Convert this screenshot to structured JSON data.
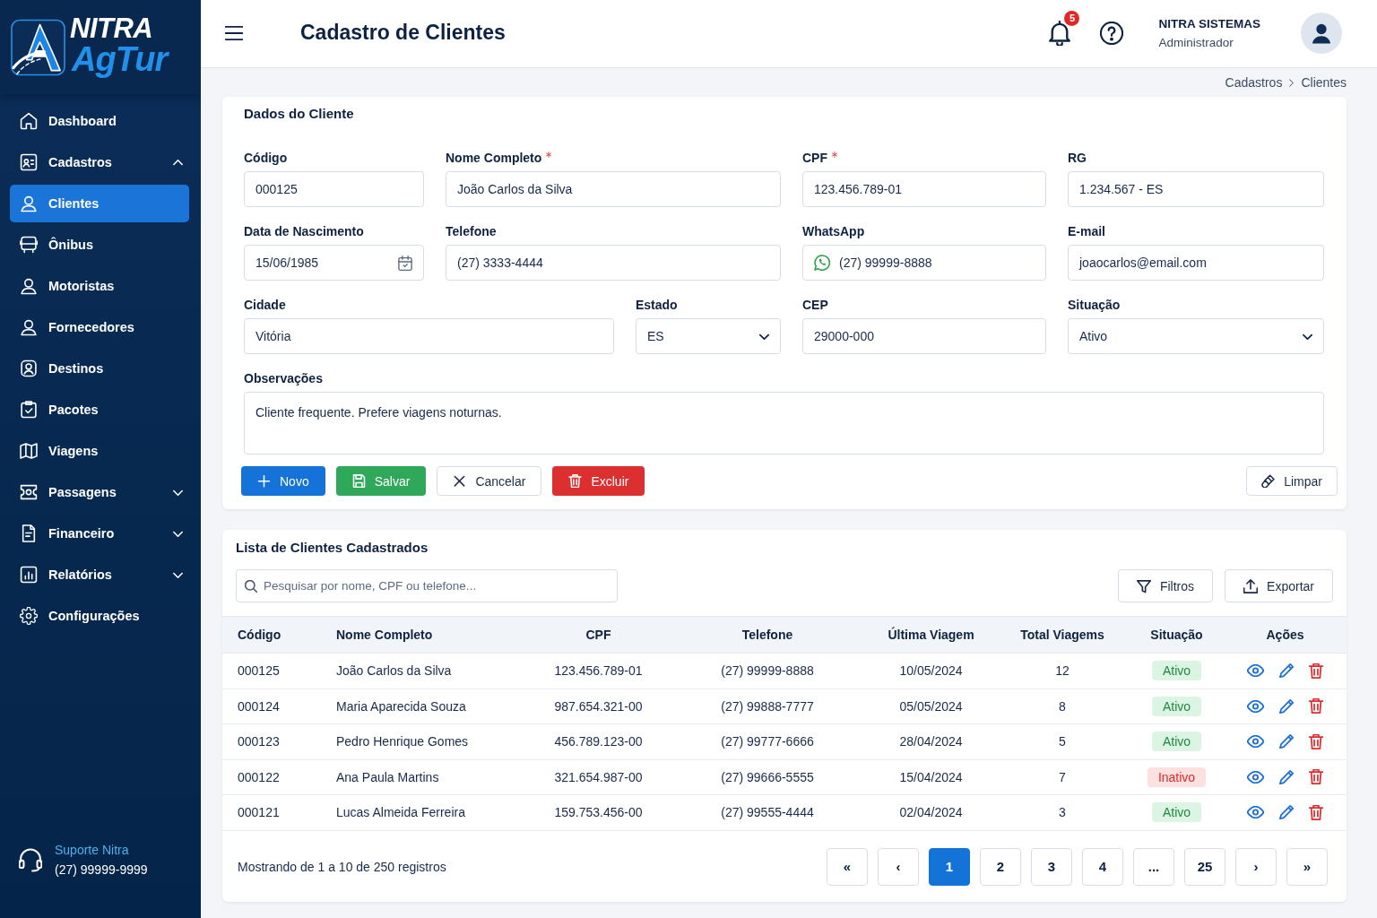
{
  "sidebar": {
    "logo": {
      "line_1": "NITRA",
      "line_2": "AgTur"
    },
    "items": [
      {
        "label": "Dashboard",
        "kind": "link",
        "selected": false
      },
      {
        "label": "Cadastros",
        "kind": "group",
        "selected": false,
        "expanded": true
      },
      {
        "label": "Clientes",
        "kind": "link",
        "selected": true
      },
      {
        "label": "Ônibus",
        "kind": "link",
        "selected": false
      },
      {
        "label": "Motoristas",
        "kind": "link",
        "selected": false
      },
      {
        "label": "Fornecedores",
        "kind": "link",
        "selected": false
      },
      {
        "label": "Destinos",
        "kind": "link",
        "selected": false
      },
      {
        "label": "Pacotes",
        "kind": "link",
        "selected": false
      },
      {
        "label": "Viagens",
        "kind": "link",
        "selected": false
      },
      {
        "label": "Passagens",
        "kind": "group",
        "selected": false,
        "expanded": false
      },
      {
        "label": "Financeiro",
        "kind": "group",
        "selected": false,
        "expanded": false
      },
      {
        "label": "Relatórios",
        "kind": "group",
        "selected": false,
        "expanded": false
      },
      {
        "label": "Configurações",
        "kind": "link",
        "selected": false
      }
    ],
    "support": {
      "title": "Suporte Nitra",
      "phone": "(27) 99999-9999"
    }
  },
  "header": {
    "title": "Cadastro de Clientes",
    "notifications": "5",
    "user": {
      "name": "NITRA SISTEMAS",
      "role": "Administrador"
    }
  },
  "breadcrumb": [
    "Cadastros",
    "Clientes"
  ],
  "client_form": {
    "title": "Dados do Cliente",
    "rows": [
      [
        {
          "label": "Código",
          "value": "000125",
          "kind": "text",
          "required": false
        },
        {
          "label": "Nome Completo",
          "value": "João Carlos da Silva",
          "kind": "text",
          "required": true
        },
        {
          "label": "CPF",
          "value": "123.456.789-01",
          "kind": "text",
          "required": true
        },
        {
          "label": "RG",
          "value": "1.234.567 - ES",
          "kind": "text",
          "required": false
        }
      ],
      [
        {
          "label": "Data de Nascimento",
          "value": "15/06/1985",
          "kind": "date",
          "required": false
        },
        {
          "label": "Telefone",
          "value": "(27) 3333-4444",
          "kind": "text",
          "required": false
        },
        {
          "label": "WhatsApp",
          "value": "(27) 99999-8888",
          "kind": "whatsapp",
          "required": false
        },
        {
          "label": "E-mail",
          "value": "joaocarlos@email.com",
          "kind": "text",
          "required": false
        }
      ],
      [
        {
          "label": "Cidade",
          "value": "Vitória",
          "kind": "text",
          "required": false
        },
        {
          "label": "Estado",
          "value": "ES",
          "kind": "select",
          "required": false
        },
        {
          "label": "CEP",
          "value": "29000-000",
          "kind": "text",
          "required": false
        },
        {
          "label": "Situação",
          "value": "Ativo",
          "kind": "select",
          "required": false
        }
      ],
      [
        {
          "label": "Observações",
          "value": "Cliente frequente. Prefere viagens noturnas.",
          "kind": "textarea",
          "required": false
        }
      ]
    ],
    "actions": [
      {
        "label": "Novo",
        "kind": "new"
      },
      {
        "label": "Salvar",
        "kind": "save"
      },
      {
        "label": "Cancelar",
        "kind": "cancel"
      },
      {
        "label": "Excluir",
        "kind": "delete"
      },
      {
        "label": "Limpar",
        "kind": "clear"
      }
    ]
  },
  "client_list": {
    "title": "Lista de Clientes Cadastrados",
    "search": {
      "placeholder": "Pesquisar por nome, CPF ou telefone..."
    },
    "tools": [
      {
        "label": "Filtros",
        "kind": "filter"
      },
      {
        "label": "Exportar",
        "kind": "export"
      }
    ],
    "table": {
      "columns": [
        "Código",
        "Nome Completo",
        "CPF",
        "Telefone",
        "Última Viagem",
        "Total Viagems",
        "Situação",
        "Ações"
      ],
      "rows": [
        {
          "cells": [
            "000125",
            "João Carlos da Silva",
            "123.456.789-01",
            "(27) 99999-8888",
            "10/05/2024",
            "12"
          ],
          "status": {
            "label": "Ativo",
            "active": true
          }
        },
        {
          "cells": [
            "000124",
            "Maria Aparecida Souza",
            "987.654.321-00",
            "(27) 99888-7777",
            "05/05/2024",
            "8"
          ],
          "status": {
            "label": "Ativo",
            "active": true
          }
        },
        {
          "cells": [
            "000123",
            "Pedro Henrique Gomes",
            "456.789.123-00",
            "(27) 99777-6666",
            "28/04/2024",
            "5"
          ],
          "status": {
            "label": "Ativo",
            "active": true
          }
        },
        {
          "cells": [
            "000122",
            "Ana Paula Martins",
            "321.654.987-00",
            "(27) 99666-5555",
            "15/04/2024",
            "7"
          ],
          "status": {
            "label": "Inativo",
            "active": false
          }
        },
        {
          "cells": [
            "000121",
            "Lucas Almeida Ferreira",
            "159.753.456-00",
            "(27) 99555-4444",
            "02/04/2024",
            "3"
          ],
          "status": {
            "label": "Ativo",
            "active": true
          }
        }
      ]
    },
    "pagination": {
      "summary": "Mostrando de 1 a 10 de 250 registros",
      "pages": [
        {
          "label": "«",
          "selected": false
        },
        {
          "label": "‹",
          "selected": false
        },
        {
          "label": "1",
          "selected": true
        },
        {
          "label": "2",
          "selected": false
        },
        {
          "label": "3",
          "selected": false
        },
        {
          "label": "4",
          "selected": false
        },
        {
          "label": "...",
          "selected": false
        },
        {
          "label": "25",
          "selected": false
        },
        {
          "label": "›",
          "selected": false
        },
        {
          "label": "»",
          "selected": false
        }
      ]
    }
  }
}
